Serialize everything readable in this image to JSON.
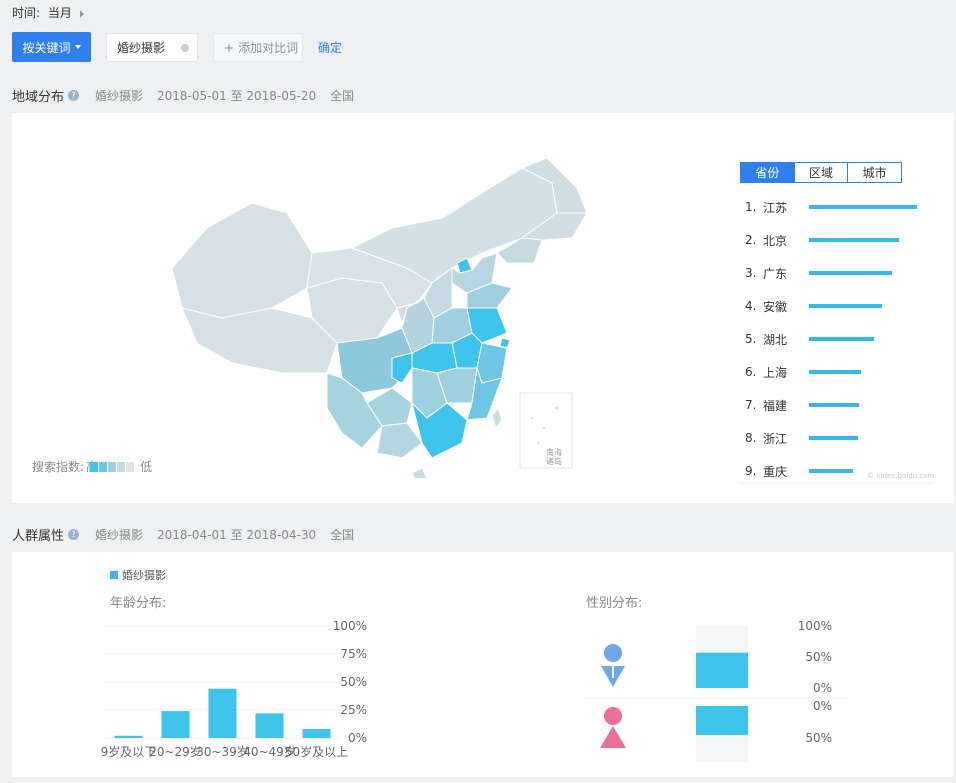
{
  "filter": {
    "time_label": "时间:",
    "time_value": "当月",
    "mode_button": "按关键词",
    "keyword": "婚纱摄影",
    "add_compare": "添加对比词",
    "confirm": "确定"
  },
  "region": {
    "title": "地域分布",
    "keyword": "婚纱摄影",
    "date_range": "2018-05-01 至 2018-05-20",
    "scope": "全国",
    "tabs": [
      "省份",
      "区域",
      "城市"
    ],
    "index_label": "搜索指数:",
    "index_high": "高",
    "index_low": "低",
    "inset_label_1": "南海",
    "inset_label_2": "诸岛",
    "watermark": "© index.baidu.com",
    "ranking": [
      {
        "rank": "1.",
        "name": "江苏",
        "value": 100
      },
      {
        "rank": "2.",
        "name": "北京",
        "value": 83
      },
      {
        "rank": "3.",
        "name": "广东",
        "value": 77
      },
      {
        "rank": "4.",
        "name": "安徽",
        "value": 68
      },
      {
        "rank": "5.",
        "name": "湖北",
        "value": 60
      },
      {
        "rank": "6.",
        "name": "上海",
        "value": 48
      },
      {
        "rank": "7.",
        "name": "福建",
        "value": 46
      },
      {
        "rank": "8.",
        "name": "浙江",
        "value": 45
      },
      {
        "rank": "9.",
        "name": "重庆",
        "value": 41
      }
    ],
    "colors": {
      "high": "#3ec3ea",
      "mid": "#9fd0df",
      "low": "#d3e0e6"
    }
  },
  "audience": {
    "title": "人群属性",
    "keyword": "婚纱摄影",
    "date_range": "2018-04-01 至 2018-04-30",
    "scope": "全国",
    "legend": "婚纱摄影",
    "age_title": "年龄分布:",
    "gender_title": "性别分布:"
  },
  "chart_data": [
    {
      "type": "bar",
      "title": "年龄分布:",
      "categories": [
        "19岁及以下",
        "20~29岁",
        "30~39岁",
        "40~49岁",
        "50岁及以上"
      ],
      "values": [
        2,
        24,
        44,
        22,
        8
      ],
      "ylim": [
        0,
        100
      ],
      "yticks": [
        "100%",
        "75%",
        "50%",
        "25%",
        "0%"
      ],
      "xtick_labels": [
        "9岁及以下",
        "20~29岁",
        "30~39岁",
        "40~49岁",
        "50岁及以上"
      ],
      "color": "#3ec3ea"
    },
    {
      "type": "bar",
      "title": "性别分布:",
      "categories": [
        "男",
        "女"
      ],
      "values": [
        54,
        46
      ],
      "male_ticks": [
        "100%",
        "50%",
        "0%"
      ],
      "female_ticks": [
        "0%",
        "50%"
      ],
      "color": "#3ec3ea",
      "male_icon_color": "#6fa8e8",
      "female_icon_color": "#ea6f9a"
    }
  ]
}
